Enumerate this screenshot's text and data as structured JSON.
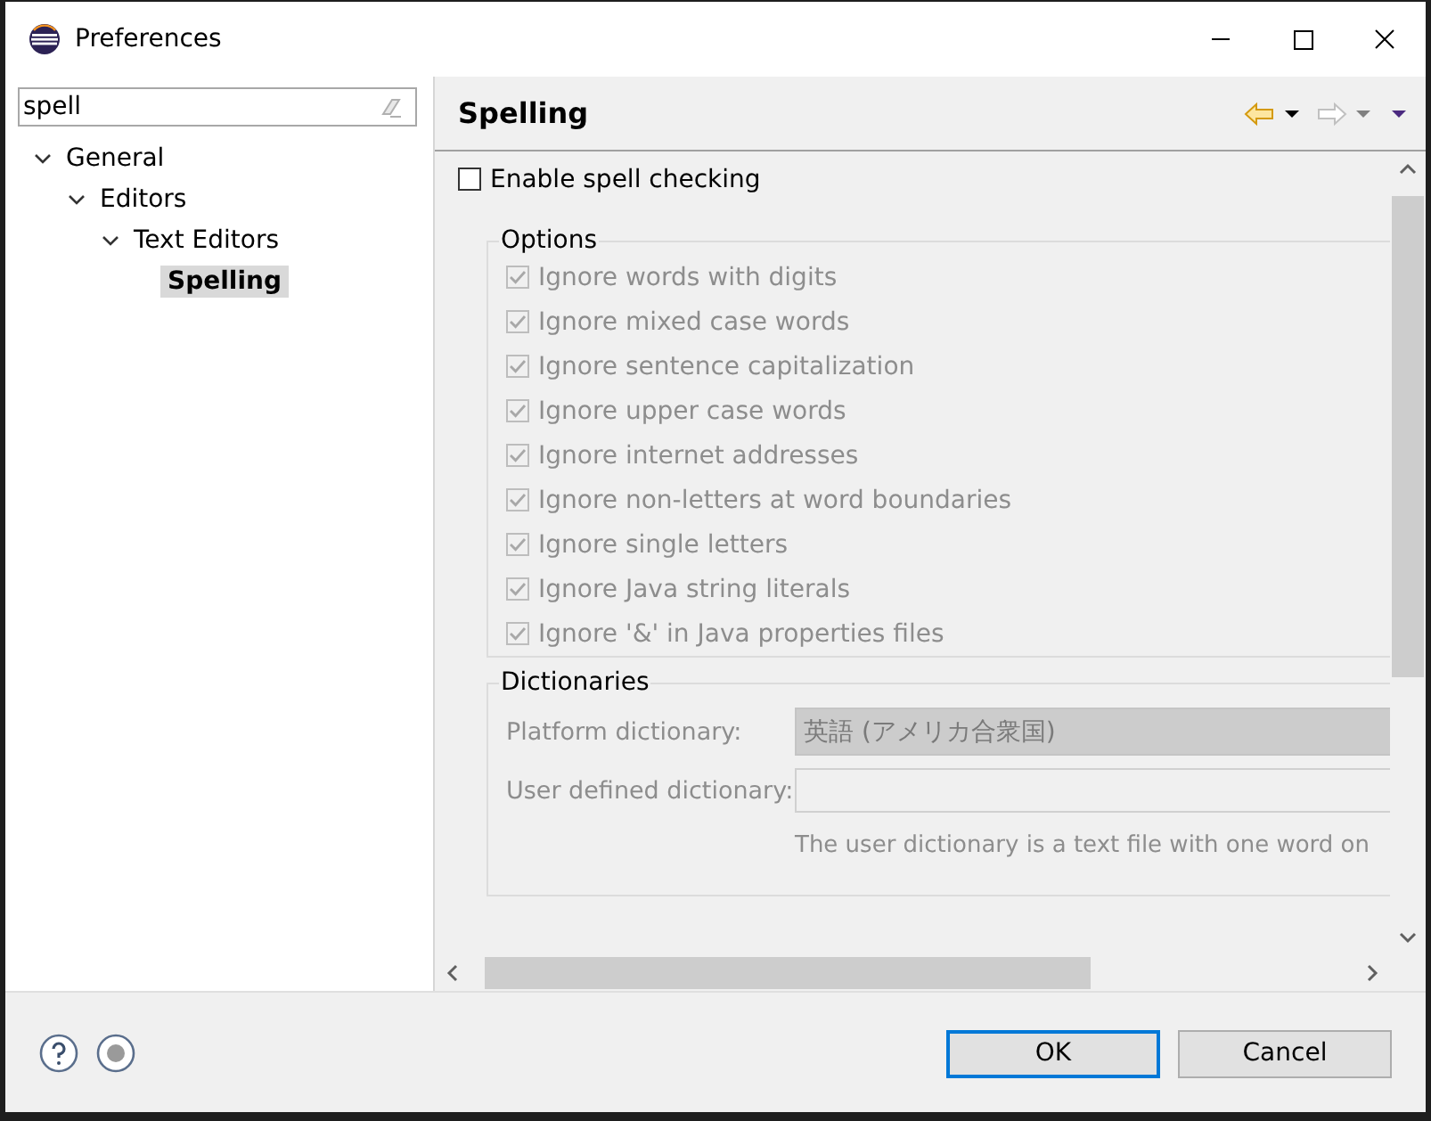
{
  "window": {
    "title": "Preferences"
  },
  "filter": {
    "value": "spell"
  },
  "tree": [
    {
      "label": "General",
      "expanded": true,
      "selected": false,
      "children": [
        {
          "label": "Editors",
          "expanded": true,
          "selected": false,
          "children": [
            {
              "label": "Text Editors",
              "expanded": true,
              "selected": false,
              "children": [
                {
                  "label": "Spelling",
                  "selected": true
                }
              ]
            }
          ]
        }
      ]
    }
  ],
  "page": {
    "title": "Spelling"
  },
  "enable": {
    "label": "Enable spell checking",
    "checked": false
  },
  "options": {
    "title": "Options",
    "items": [
      {
        "label": "Ignore words with digits",
        "checked": true,
        "disabled": true
      },
      {
        "label": "Ignore mixed case words",
        "checked": true,
        "disabled": true
      },
      {
        "label": "Ignore sentence capitalization",
        "checked": true,
        "disabled": true
      },
      {
        "label": "Ignore upper case words",
        "checked": true,
        "disabled": true
      },
      {
        "label": "Ignore internet addresses",
        "checked": true,
        "disabled": true
      },
      {
        "label": "Ignore non-letters at word boundaries",
        "checked": true,
        "disabled": true
      },
      {
        "label": "Ignore single letters",
        "checked": true,
        "disabled": true
      },
      {
        "label": "Ignore Java string literals",
        "checked": true,
        "disabled": true
      },
      {
        "label": "Ignore '&' in Java properties files",
        "checked": true,
        "disabled": true
      }
    ]
  },
  "dictionaries": {
    "title": "Dictionaries",
    "platform": {
      "label": "Platform dictionary:",
      "value": "英語 (アメリカ合衆国)",
      "disabled": true
    },
    "user": {
      "label": "User defined dictionary:",
      "disabled": true
    },
    "hint": "The user dictionary is a text file with one word on"
  },
  "buttons": [
    {
      "label": "OK",
      "default": true
    },
    {
      "label": "Cancel",
      "default": false
    }
  ]
}
